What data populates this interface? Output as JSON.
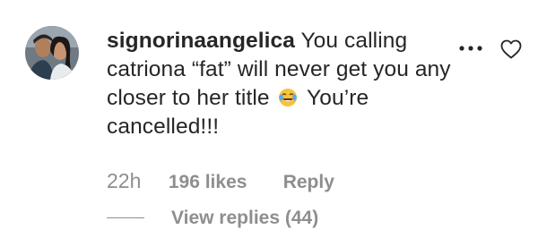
{
  "comment": {
    "username": "signorinaangelica",
    "text_part1": "You calling catriona “fat” will never get you any closer to her title",
    "emoji": "face-with-tears-of-joy-emoji",
    "text_part2": "You’re cancelled!!!",
    "time": "22h",
    "likes": "196 likes",
    "reply_label": "Reply",
    "view_replies_label": "View replies (44)"
  },
  "icons": {
    "more": "more-options-icon",
    "like": "heart-icon"
  },
  "colors": {
    "text": "#262626",
    "secondary": "#8e8e8e",
    "emoji_face": "#f7c23c"
  }
}
